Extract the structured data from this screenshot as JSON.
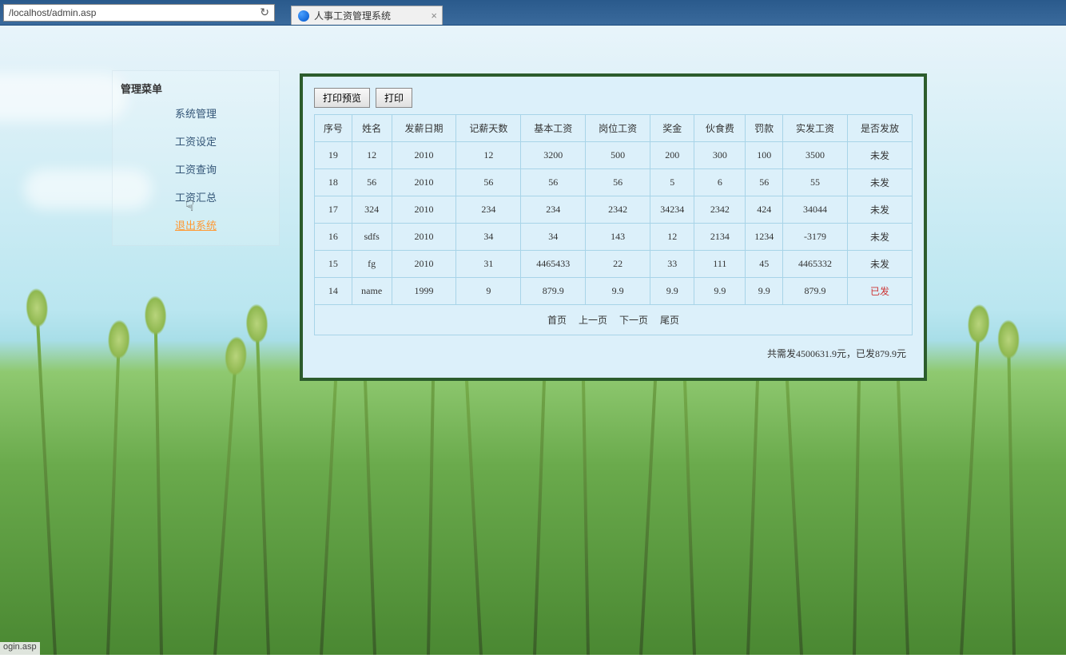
{
  "browser": {
    "url": "/localhost/admin.asp",
    "tab_title": "人事工资管理系统",
    "status_url": "ogin.asp"
  },
  "sidebar": {
    "title": "管理菜单",
    "items": [
      {
        "label": "系统管理",
        "active": false
      },
      {
        "label": "工资设定",
        "active": false
      },
      {
        "label": "工资查询",
        "active": false
      },
      {
        "label": "工资汇总",
        "active": false
      },
      {
        "label": "退出系统",
        "active": true
      }
    ]
  },
  "buttons": {
    "print_preview": "打印预览",
    "print": "打印"
  },
  "table": {
    "headers": [
      "序号",
      "姓名",
      "发薪日期",
      "记薪天数",
      "基本工资",
      "岗位工资",
      "奖金",
      "伙食费",
      "罚款",
      "实发工资",
      "是否发放"
    ],
    "rows": [
      {
        "cells": [
          "19",
          "12",
          "2010",
          "12",
          "3200",
          "500",
          "200",
          "300",
          "100",
          "3500",
          "未发"
        ],
        "sent": false
      },
      {
        "cells": [
          "18",
          "56",
          "2010",
          "56",
          "56",
          "56",
          "5",
          "6",
          "56",
          "55",
          "未发"
        ],
        "sent": false
      },
      {
        "cells": [
          "17",
          "324",
          "2010",
          "234",
          "234",
          "2342",
          "34234",
          "2342",
          "424",
          "34044",
          "未发"
        ],
        "sent": false
      },
      {
        "cells": [
          "16",
          "sdfs",
          "2010",
          "34",
          "34",
          "143",
          "12",
          "2134",
          "1234",
          "-3179",
          "未发"
        ],
        "sent": false
      },
      {
        "cells": [
          "15",
          "fg",
          "2010",
          "31",
          "4465433",
          "22",
          "33",
          "111",
          "45",
          "4465332",
          "未发"
        ],
        "sent": false
      },
      {
        "cells": [
          "14",
          "name",
          "1999",
          "9",
          "879.9",
          "9.9",
          "9.9",
          "9.9",
          "9.9",
          "879.9",
          "已发"
        ],
        "sent": true
      }
    ]
  },
  "pagination": {
    "first": "首页",
    "prev": "上一页",
    "next": "下一页",
    "last": "尾页"
  },
  "summary": "共需发4500631.9元，已发879.9元"
}
